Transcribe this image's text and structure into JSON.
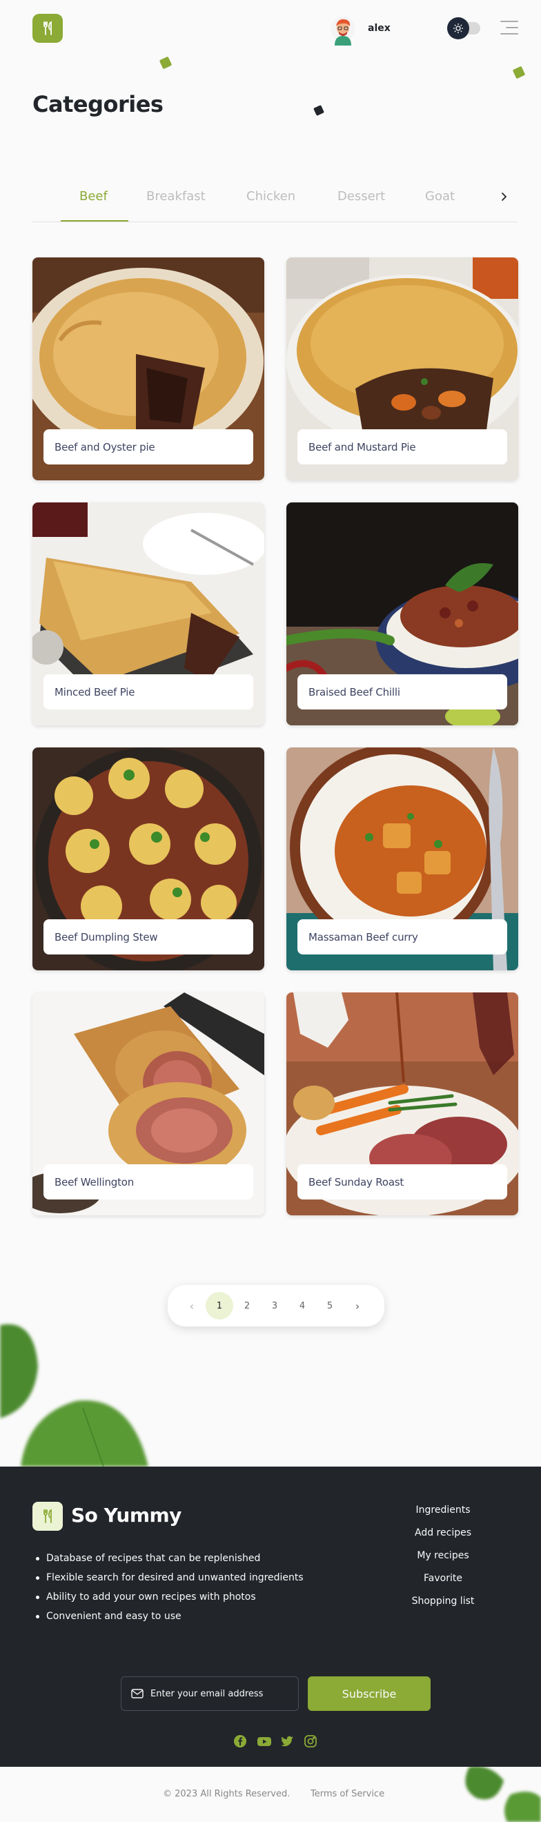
{
  "header": {
    "username": "alex",
    "logo_icon": "fork-knife-icon",
    "theme_icon": "sun-icon",
    "menu_icon": "burger-menu-icon"
  },
  "page": {
    "title": "Categories"
  },
  "tabs": {
    "items": [
      "Beef",
      "Breakfast",
      "Chicken",
      "Dessert",
      "Goat"
    ],
    "active": "Beef",
    "next_icon": "chevron-right-icon"
  },
  "recipes": [
    {
      "title": "Beef and Oyster pie"
    },
    {
      "title": "Beef and Mustard Pie"
    },
    {
      "title": "Minced Beef Pie"
    },
    {
      "title": "Braised Beef Chilli"
    },
    {
      "title": "Beef Dumpling Stew"
    },
    {
      "title": "Massaman Beef curry"
    },
    {
      "title": "Beef Wellington"
    },
    {
      "title": "Beef Sunday Roast"
    }
  ],
  "pagination": {
    "prev": "‹",
    "next": "›",
    "pages": [
      "1",
      "2",
      "3",
      "4",
      "5"
    ],
    "current": "1"
  },
  "footer": {
    "brand": "So Yummy",
    "features": [
      "Database of recipes that can be replenished",
      "Flexible search for desired and unwanted ingredients",
      "Ability to add your own recipes with photos",
      "Convenient and easy to use"
    ],
    "nav": [
      "Ingredients",
      "Add recipes",
      "My recipes",
      "Favorite",
      "Shopping list"
    ],
    "email_placeholder": "Enter your email address",
    "subscribe_label": "Subscribe",
    "socials": [
      "facebook-icon",
      "youtube-icon",
      "twitter-icon",
      "instagram-icon"
    ]
  },
  "bottom": {
    "copyright": "© 2023 All Rights Reserved.",
    "terms": "Terms of Service"
  },
  "colors": {
    "accent": "#8baa36",
    "dark": "#22252a",
    "background": "#fafafa"
  }
}
